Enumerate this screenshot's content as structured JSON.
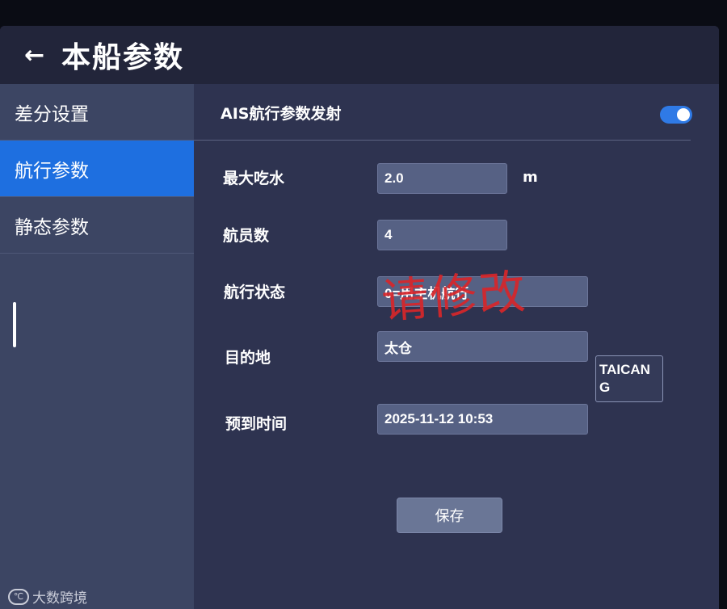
{
  "header": {
    "back_icon": "←",
    "title": "本船参数"
  },
  "sidebar": {
    "items": [
      {
        "label": "差分设置",
        "active": false
      },
      {
        "label": "航行参数",
        "active": true
      },
      {
        "label": "静态参数",
        "active": false
      }
    ]
  },
  "main": {
    "ais_toggle": {
      "label": "AIS航行参数发射",
      "on": true
    },
    "max_draught": {
      "label": "最大吃水",
      "value": "2.0",
      "unit": "m"
    },
    "crew_count": {
      "label": "航员数",
      "value": "4"
    },
    "nav_status": {
      "label": "航行状态",
      "value": "0=用主机航行"
    },
    "destination": {
      "label": "目的地",
      "value": "太仓",
      "suggestion": "TAICANG"
    },
    "eta": {
      "label": "预到时间",
      "value": "2025-11-12 10:53"
    },
    "save_label": "保存"
  },
  "annotation": {
    "text": "请修改",
    "color": "#d8262a"
  },
  "watermark": {
    "text": "大数跨境"
  },
  "colors": {
    "accent": "#1e6fe0",
    "toggle_on": "#2f7ae6",
    "background": "#2e3350"
  }
}
